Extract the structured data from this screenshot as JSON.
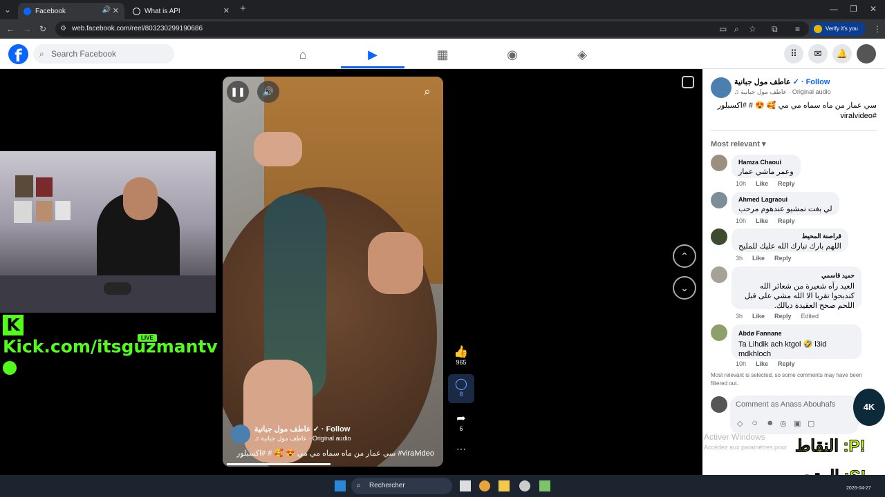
{
  "browser": {
    "tabs": [
      {
        "title": "Facebook",
        "active": true
      },
      {
        "title": "What is API",
        "active": false
      }
    ],
    "url": "web.facebook.com/reel/803230299190686",
    "verify_label": "Verify it's you"
  },
  "fb": {
    "logo": "f",
    "search_placeholder": "Search Facebook",
    "nav": [
      {
        "icon": "home-icon",
        "active": false
      },
      {
        "icon": "reels-icon",
        "active": true
      },
      {
        "icon": "marketplace-icon",
        "active": false
      },
      {
        "icon": "groups-icon",
        "active": false
      },
      {
        "icon": "gaming-icon",
        "active": false
      }
    ]
  },
  "reel": {
    "author": "عاطف مول جبانية",
    "follow": "Follow",
    "audio": "عاطف مول جبانية · Original audio",
    "caption": "سي عمار من ماه سماه مي مي 😍 🥰 # #اكسبلور #viralvideo",
    "likes": "965",
    "comments": "8",
    "shares": "6"
  },
  "stream": {
    "kick_text": "Kick.com/itsguzmantv",
    "live_badge": "LIVE"
  },
  "post": {
    "author": "عاطف مول جبانية",
    "follow": "Follow",
    "audio": "عاطف مول جبانية · Original audio",
    "caption": "سي عمار من ماه سماه مي مي 🥰 😍 # #اكسبلور #viralvideo",
    "sort_label": "Most relevant",
    "comments": [
      {
        "name": "Hamza Chaoui",
        "text": "وعمر ماشي عمار",
        "time": "10h",
        "like": "Like",
        "reply": "Reply",
        "edited": ""
      },
      {
        "name": "Ahmed Lagraoui",
        "text": "لي بغت نمشيو عندهوم مرحب",
        "time": "10h",
        "like": "Like",
        "reply": "Reply",
        "edited": ""
      },
      {
        "name": "قراصنة المحيط",
        "text": "اللهم بارك تبارك الله عليك للمليح",
        "time": "3h",
        "like": "Like",
        "reply": "Reply",
        "edited": ""
      },
      {
        "name": "حميد قاسمي",
        "text": "العيد رآه شعيرة من شعائر الله كندبحوا تقربا الا الله مشي على قبل اللحم صحح العقيدة ديالك.",
        "time": "3h",
        "like": "Like",
        "reply": "Reply",
        "edited": "Edited"
      },
      {
        "name": "Abdø Fannane",
        "text": "Ta Lihdik ach ktgol 🤣 l3id mdkhloch",
        "time": "10h",
        "like": "Like",
        "reply": "Reply",
        "edited": ""
      }
    ],
    "filter_note": "Most relevant is selected, so some comments may have been filtered out.",
    "comment_placeholder": "Comment as Anass Abouhafs"
  },
  "overlay": {
    "activate_title": "Activer Windows",
    "activate_sub": "Accédez aux paramètres pour",
    "arabic1": "النقاط :P!",
    "arabic2": "المتجر :S!",
    "logo_text": "4K"
  },
  "taskbar": {
    "search": "Rechercher",
    "date": "2026-04-27"
  }
}
